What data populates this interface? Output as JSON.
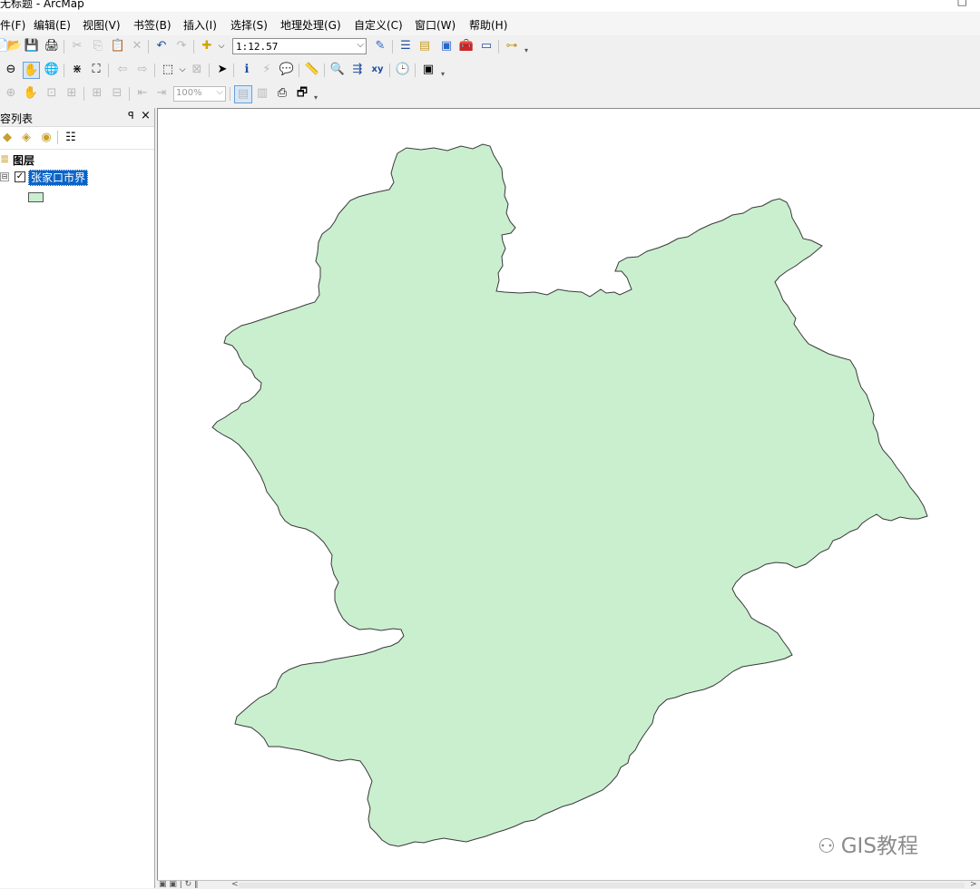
{
  "window": {
    "title": "无标题 - ArcMap",
    "restore_glyph": "□"
  },
  "menu": [
    {
      "id": "file",
      "label": "文件(F)"
    },
    {
      "id": "edit",
      "label": "编辑(E)"
    },
    {
      "id": "view",
      "label": "视图(V)"
    },
    {
      "id": "bookmarks",
      "label": "书签(B)"
    },
    {
      "id": "insert",
      "label": "插入(I)"
    },
    {
      "id": "selection",
      "label": "选择(S)"
    },
    {
      "id": "geoprocessing",
      "label": "地理处理(G)"
    },
    {
      "id": "customize",
      "label": "自定义(C)"
    },
    {
      "id": "window",
      "label": "窗口(W)"
    },
    {
      "id": "help",
      "label": "帮助(H)"
    }
  ],
  "toolbar": {
    "scale_value": "1:12.57",
    "layout_zoom_value": "100%",
    "dropdown_glyph": "⌵",
    "grip_glyph": "▾",
    "icons": {
      "new": "📄",
      "open": "📂",
      "save": "💾",
      "print": "🖨",
      "cut": "✂",
      "copy": "⎘",
      "paste": "📋",
      "delete": "✕",
      "undo": "↶",
      "redo": "↷",
      "add_data": "✚",
      "editor": "✎",
      "toc": "☰",
      "catalog": "▤",
      "search": "▣",
      "arctoolbox": "🧰",
      "python": "▭",
      "model": "⊶",
      "zoom_out": "⊖",
      "pan": "✋",
      "full_extent": "🌐",
      "fixed_zoom_in": "⋇",
      "fixed_zoom_out": "⛶",
      "back": "⇦",
      "forward": "⇨",
      "select_features": "⬚",
      "clear_selection": "⊠",
      "select_elements": "➤",
      "identify": "ℹ",
      "hyperlink": "⚡",
      "html_popup": "💬",
      "measure": "📏",
      "find": "🔍",
      "route": "⇶",
      "goto_xy": "xy",
      "time_slider": "🕒",
      "viewer": "▣",
      "layout_zoom_in": "⊕",
      "layout_pan": "✋",
      "layout_full": "⊡",
      "layout_whole": "⊞",
      "layout_fixed_in": "⊞",
      "layout_fixed_out": "⊟",
      "layout_back": "⇤",
      "layout_forward": "⇥",
      "toggle_draft": "▤",
      "focus_frame": "▥",
      "change_layout": "⎙",
      "dataview_toggle": "🗗"
    }
  },
  "toc": {
    "title": "内容列表",
    "pin_glyph": "ꟼ",
    "close_glyph": "×",
    "tools": {
      "by_drawing_order": "◆",
      "by_source": "◈",
      "by_visibility": "◉",
      "by_selection": "☷"
    },
    "layers_label": "图层",
    "layers_glyph": "≣",
    "expander_glyph": "⊟",
    "check_glyph": "✓",
    "layer": {
      "name": "张家口市界",
      "visible": true,
      "fill_color": "#c9efcf",
      "outline_color": "#555555"
    }
  },
  "map": {
    "background": "#ffffff",
    "feature_fill": "#c9efcf",
    "feature_stroke": "#3a3a3a"
  },
  "watermark": {
    "glyph": "⚇",
    "text": "GIS教程"
  },
  "statusbar": {
    "left_glyphs": "▣ ▣ | ↻ ‖",
    "scroll_left": "<",
    "scroll_right": ">"
  }
}
